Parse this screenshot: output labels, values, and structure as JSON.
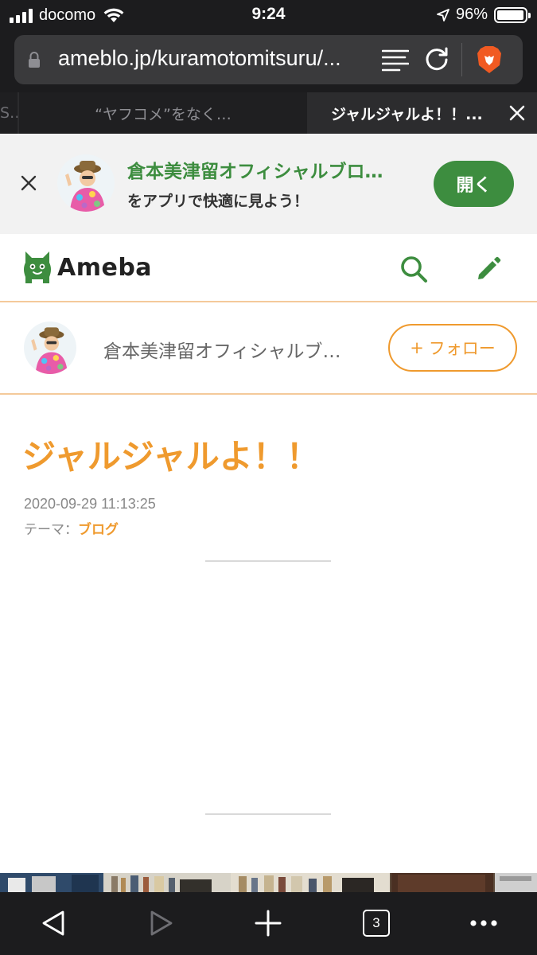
{
  "status_bar": {
    "carrier": "docomo",
    "time": "9:24",
    "battery_text": "96%",
    "battery_level": 0.96,
    "icons": [
      "signal-icon",
      "wifi-icon",
      "location-arrow-icon",
      "battery-icon"
    ]
  },
  "browser": {
    "url": "ameblo.jp/kuramotomitsuru/...",
    "icons": [
      "lock-icon",
      "reader-mode-icon",
      "reload-icon",
      "brave-lion-icon"
    ],
    "tabs": [
      {
        "label": "S…"
      },
      {
        "label": "“ヤフコメ”をなく…"
      },
      {
        "label": "ジャルジャルよ！！..."
      }
    ]
  },
  "app_banner": {
    "title": "倉本美津留オフィシャルブロ…",
    "subtitle": "をアプリで快適に見よう！",
    "open_label": "開く"
  },
  "ameba_header": {
    "logo_text": "Ameba",
    "icons": [
      "ameba-logo-icon",
      "search-icon",
      "pencil-icon"
    ]
  },
  "blog_header": {
    "name": "倉本美津留オフィシャルブ…",
    "follow_plus": "+",
    "follow_label": "フォロー"
  },
  "article": {
    "title": "ジャルジャルよ！！",
    "date": "2020-09-29 11:13:25",
    "theme_label": "テーマ：",
    "theme_value": "ブログ"
  },
  "bottom_toolbar": {
    "tab_count": "3",
    "icons": [
      "back-icon",
      "forward-icon",
      "new-tab-icon",
      "tabs-icon",
      "more-icon"
    ]
  },
  "colors": {
    "ameba_green": "#3d8d3f",
    "accent_orange": "#ef9a2e",
    "chrome_dark": "#1c1c1e"
  }
}
